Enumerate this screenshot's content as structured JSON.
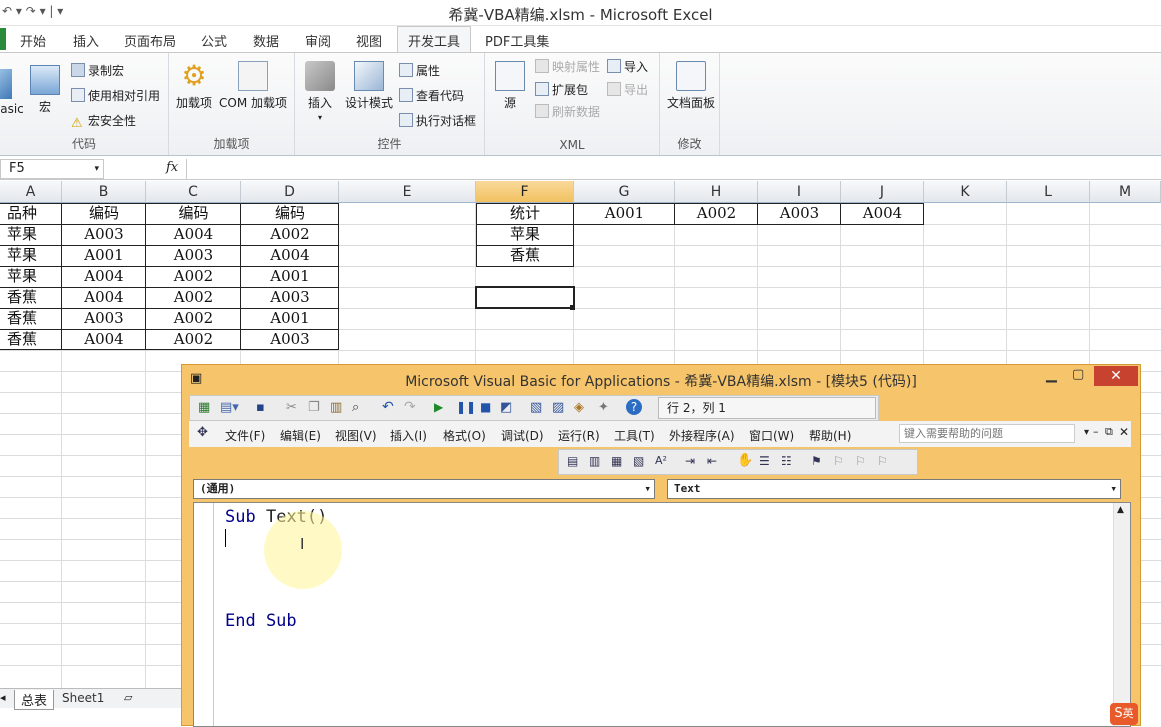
{
  "window_title": "希冀-VBA精编.xlsm - Microsoft Excel",
  "tabs": [
    "开始",
    "插入",
    "页面布局",
    "公式",
    "数据",
    "审阅",
    "视图",
    "开发工具",
    "PDF工具集"
  ],
  "ribbon": {
    "code_group": {
      "label": "代码",
      "basic": "asic",
      "macro": "宏",
      "record": "录制宏",
      "relative": "使用相对引用",
      "security": "宏安全性"
    },
    "addins_group": {
      "label": "加载项",
      "addins": "加载项",
      "com": "COM 加载项"
    },
    "controls_group": {
      "label": "控件",
      "insert": "插入",
      "design": "设计模式",
      "properties": "属性",
      "view_code": "查看代码",
      "run_dialog": "执行对话框"
    },
    "xml_group": {
      "label": "XML",
      "source": "源",
      "map_props": "映射属性",
      "expansion": "扩展包",
      "refresh": "刷新数据",
      "import": "导入",
      "export": "导出"
    },
    "modify_group": {
      "label": "修改",
      "doc_panel": "文档面板"
    }
  },
  "formula_bar": {
    "name_box": "F5",
    "fx": "fx"
  },
  "columns": [
    "A",
    "B",
    "C",
    "D",
    "E",
    "F",
    "G",
    "H",
    "I",
    "J",
    "K",
    "L",
    "M"
  ],
  "cells": {
    "A": [
      "品种",
      "苹果",
      "苹果",
      "苹果",
      "香蕉",
      "香蕉",
      "香蕉"
    ],
    "B": [
      "编码",
      "A003",
      "A001",
      "A004",
      "A004",
      "A003",
      "A004"
    ],
    "C": [
      "编码",
      "A004",
      "A003",
      "A002",
      "A002",
      "A002",
      "A002"
    ],
    "D": [
      "编码",
      "A002",
      "A004",
      "A001",
      "A003",
      "A001",
      "A003"
    ],
    "F": [
      "统计",
      "苹果",
      "香蕉"
    ],
    "G1": "A001",
    "H1": "A002",
    "I1": "A003",
    "J1": "A004"
  },
  "sheets": [
    "总表",
    "Sheet1"
  ],
  "vba": {
    "title": "Microsoft Visual Basic for Applications - 希冀-VBA精编.xlsm - [模块5 (代码)]",
    "position": "行 2，列 1",
    "menus": [
      "文件(F)",
      "编辑(E)",
      "视图(V)",
      "插入(I)",
      "格式(O)",
      "调试(D)",
      "运行(R)",
      "工具(T)",
      "外接程序(A)",
      "窗口(W)",
      "帮助(H)"
    ],
    "help_placeholder": "键入需要帮助的问题",
    "combo_object": "(通用)",
    "combo_proc": "Text",
    "code": {
      "kw_sub": "Sub",
      "name": "Text()",
      "kw_end": "End Sub"
    },
    "ime": "英"
  },
  "colors": {
    "accent": "#f6c46a",
    "selected_header": "#f1c15f",
    "code_keyword": "#00008b"
  }
}
